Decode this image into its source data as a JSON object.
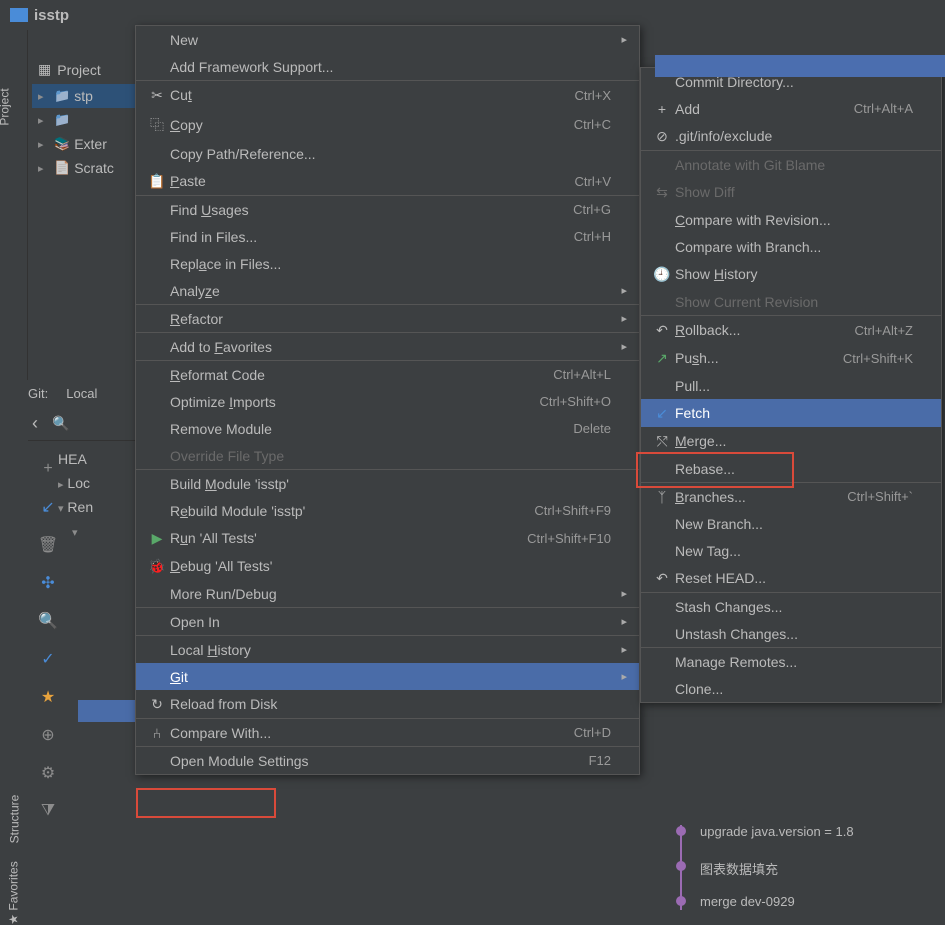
{
  "titlebar": {
    "text": "isstp"
  },
  "sidebar": {
    "project_tab": "Project",
    "structure_tab": "Structure",
    "favorites_tab": "Favorites"
  },
  "project": {
    "header": "Project",
    "items": [
      {
        "label": "stp",
        "selected": true
      },
      {
        "label": ""
      },
      {
        "label": "Exter"
      },
      {
        "label": "Scratc"
      }
    ]
  },
  "git_panel": {
    "title": "Git:",
    "local": "Local",
    "head": "HEA",
    "loc": "Loc",
    "ren": "Ren"
  },
  "commits": [
    "upgrade java.version = 1.8",
    "图表数据填充",
    "merge   dev-0929"
  ],
  "context_menu": [
    {
      "label": "New",
      "arrow": true
    },
    {
      "label": "Add Framework Support..."
    },
    {
      "sep": true
    },
    {
      "icon": "✂",
      "label": "Cut",
      "shortcut": "Ctrl+X",
      "u": 2
    },
    {
      "icon": "⿻",
      "label": "Copy",
      "shortcut": "Ctrl+C",
      "u": 0
    },
    {
      "label": "Copy Path/Reference..."
    },
    {
      "icon": "📋",
      "label": "Paste",
      "shortcut": "Ctrl+V",
      "u": 0
    },
    {
      "sep": true
    },
    {
      "label": "Find Usages",
      "shortcut": "Ctrl+G",
      "u": 5
    },
    {
      "label": "Find in Files...",
      "shortcut": "Ctrl+H"
    },
    {
      "label": "Replace in Files...",
      "u": 4
    },
    {
      "label": "Analyze",
      "arrow": true,
      "u": 5
    },
    {
      "sep": true
    },
    {
      "label": "Refactor",
      "arrow": true,
      "u": 0
    },
    {
      "sep": true
    },
    {
      "label": "Add to Favorites",
      "arrow": true,
      "u": 7
    },
    {
      "sep": true
    },
    {
      "label": "Reformat Code",
      "shortcut": "Ctrl+Alt+L",
      "u": 0
    },
    {
      "label": "Optimize Imports",
      "shortcut": "Ctrl+Shift+O",
      "u": 9
    },
    {
      "label": "Remove Module",
      "shortcut": "Delete"
    },
    {
      "label": "Override File Type",
      "disabled": true
    },
    {
      "sep": true
    },
    {
      "label": "Build Module 'isstp'",
      "u": 6
    },
    {
      "label": "Rebuild Module 'isstp'",
      "shortcut": "Ctrl+Shift+F9",
      "u": 1
    },
    {
      "icon": "▶",
      "iconColor": "#59a869",
      "label": "Run 'All Tests'",
      "shortcut": "Ctrl+Shift+F10",
      "u": 1
    },
    {
      "icon": "🐞",
      "iconColor": "#59a869",
      "label": "Debug 'All Tests'",
      "u": 0
    },
    {
      "label": "More Run/Debug",
      "arrow": true
    },
    {
      "sep": true
    },
    {
      "label": "Open In",
      "arrow": true
    },
    {
      "sep": true
    },
    {
      "label": "Local History",
      "arrow": true,
      "u": 6
    },
    {
      "label": "Git",
      "arrow": true,
      "selected": true,
      "u": 0
    },
    {
      "icon": "↻",
      "label": "Reload from Disk"
    },
    {
      "sep": true
    },
    {
      "icon": "⑃",
      "label": "Compare With...",
      "shortcut": "Ctrl+D"
    },
    {
      "sep": true
    },
    {
      "label": "Open Module Settings",
      "shortcut": "F12"
    }
  ],
  "git_submenu": [
    {
      "label": "Commit Directory..."
    },
    {
      "icon": "+",
      "label": "Add",
      "shortcut": "Ctrl+Alt+A"
    },
    {
      "icon": "⊘",
      "label": ".git/info/exclude"
    },
    {
      "sep": true
    },
    {
      "label": "Annotate with Git Blame",
      "disabled": true
    },
    {
      "icon": "⇆",
      "label": "Show Diff",
      "disabled": true
    },
    {
      "label": "Compare with Revision...",
      "u": 0
    },
    {
      "label": "Compare with Branch..."
    },
    {
      "icon": "🕘",
      "label": "Show History",
      "u": 5
    },
    {
      "label": "Show Current Revision",
      "disabled": true
    },
    {
      "sep": true
    },
    {
      "icon": "↶",
      "label": "Rollback...",
      "shortcut": "Ctrl+Alt+Z",
      "u": 0
    },
    {
      "icon": "↗",
      "iconColor": "#59a869",
      "label": "Push...",
      "shortcut": "Ctrl+Shift+K",
      "u": 2
    },
    {
      "label": "Pull..."
    },
    {
      "icon": "↙",
      "iconColor": "#4a8cd8",
      "label": "Fetch",
      "selected": true
    },
    {
      "icon": "⤲",
      "label": "Merge...",
      "u": 0
    },
    {
      "label": "Rebase..."
    },
    {
      "sep": true
    },
    {
      "icon": "ᛉ",
      "label": "Branches...",
      "shortcut": "Ctrl+Shift+`",
      "u": 0
    },
    {
      "label": "New Branch..."
    },
    {
      "label": "New Tag..."
    },
    {
      "icon": "↶",
      "label": "Reset HEAD..."
    },
    {
      "sep": true
    },
    {
      "label": "Stash Changes..."
    },
    {
      "label": "Unstash Changes..."
    },
    {
      "sep": true
    },
    {
      "label": "Manage Remotes..."
    },
    {
      "label": "Clone..."
    }
  ]
}
